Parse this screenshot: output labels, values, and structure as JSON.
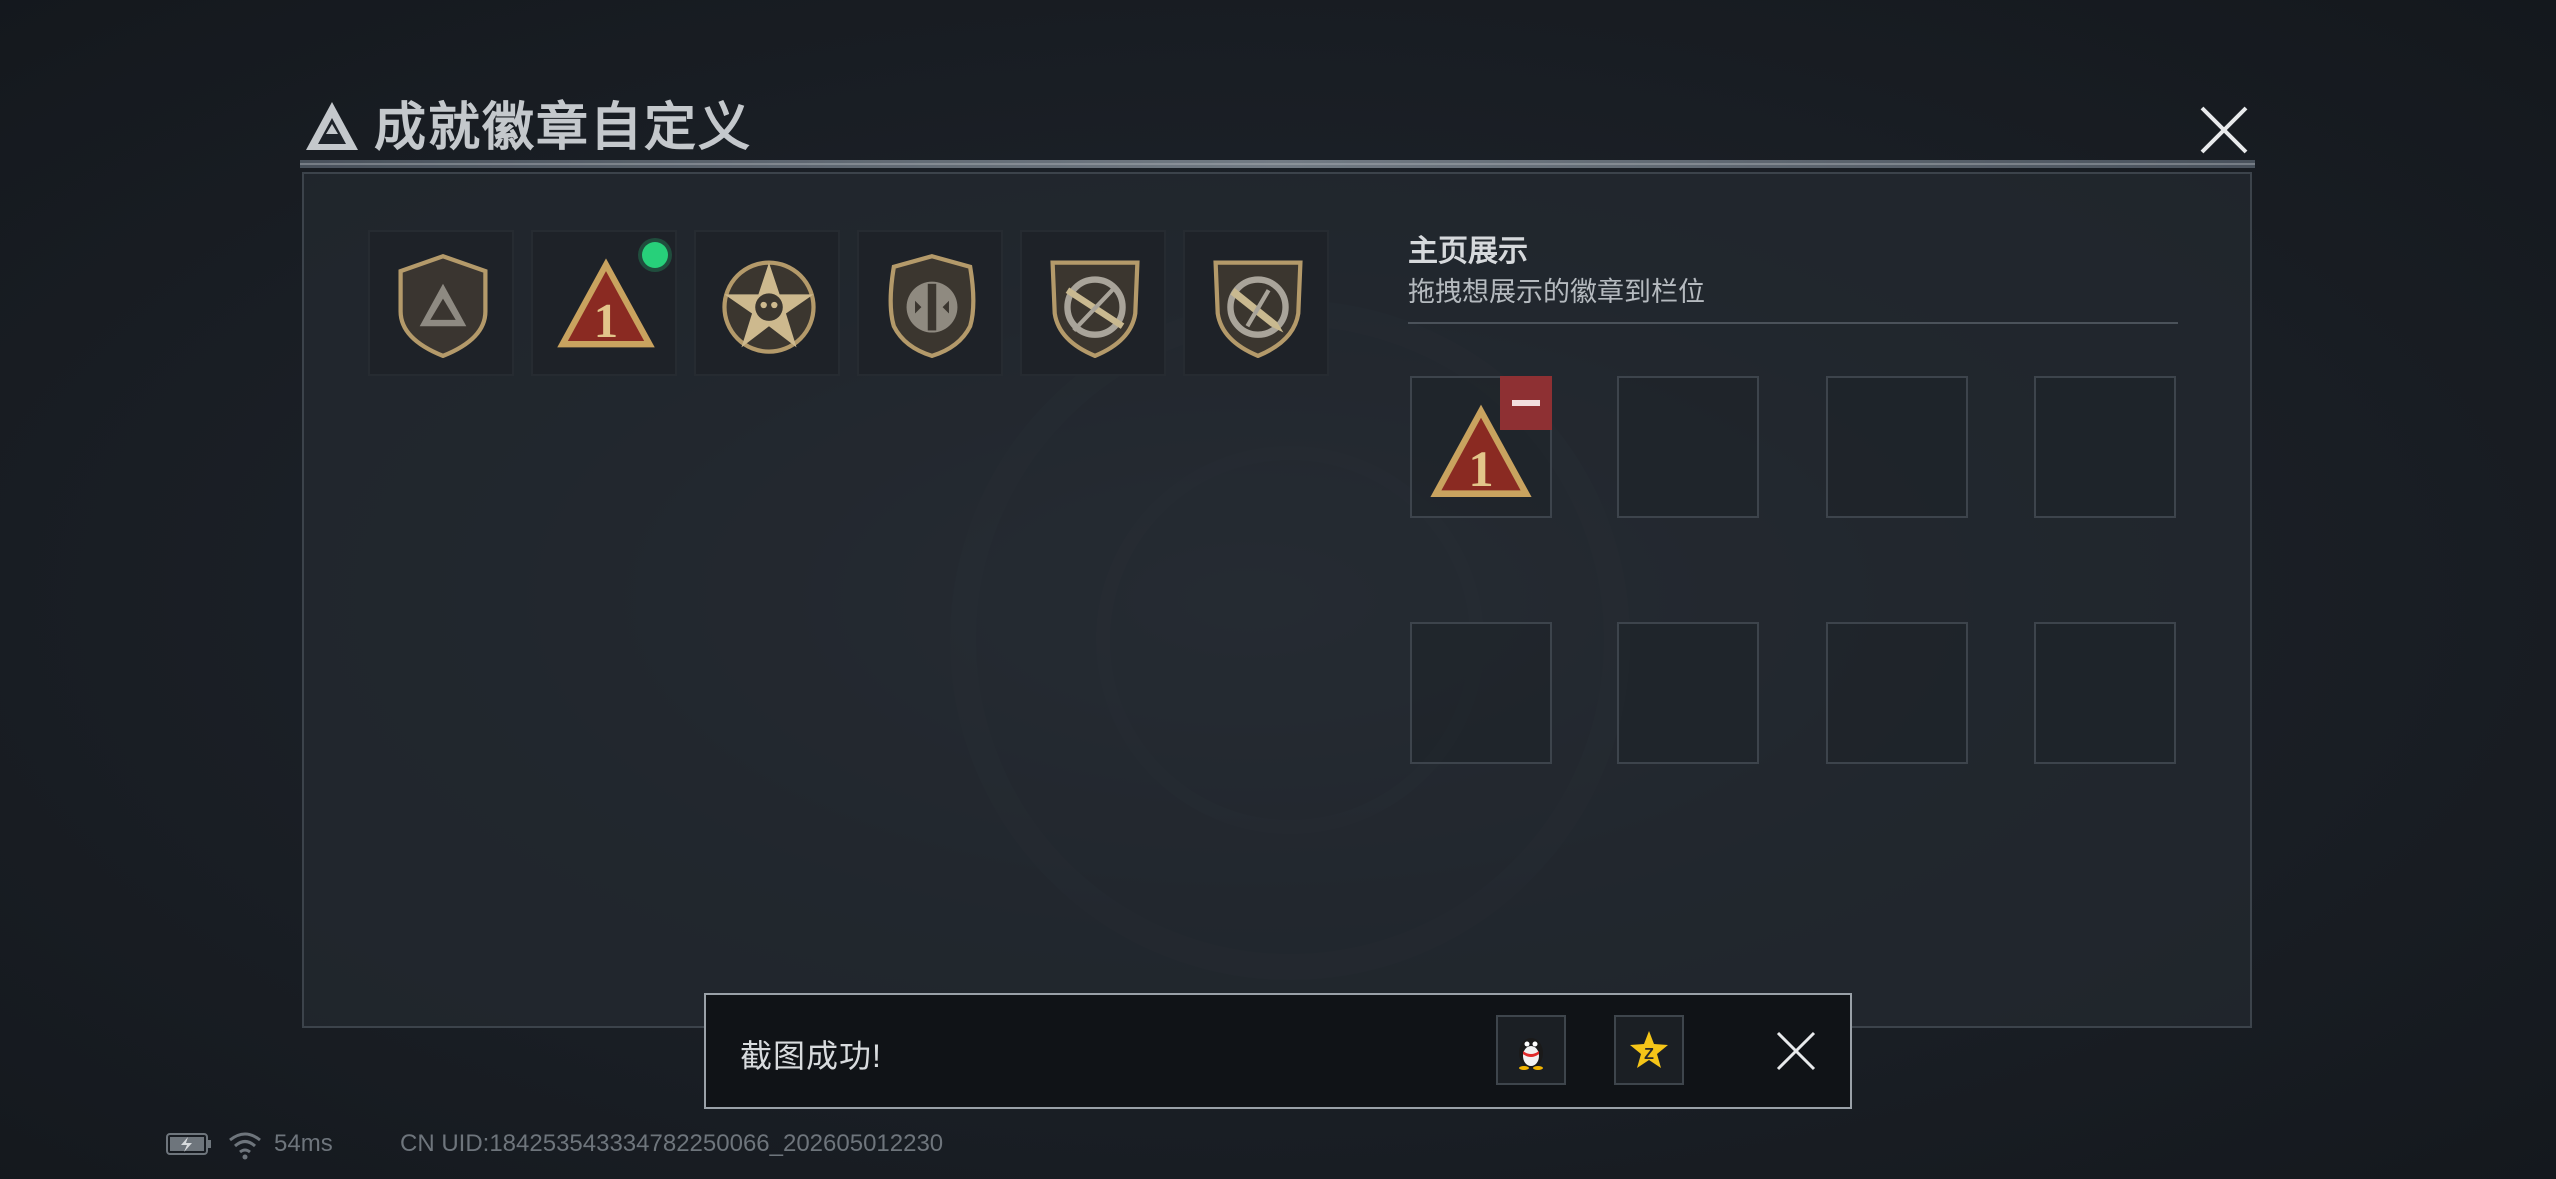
{
  "header": {
    "title": "成就徽章自定义"
  },
  "inventory": {
    "badges": [
      {
        "icon": "triangle-logo-shield-badge"
      },
      {
        "icon": "rank-one-triangle-badge",
        "is_new": true
      },
      {
        "icon": "star-skull-badge"
      },
      {
        "icon": "bullet-shield-badge"
      },
      {
        "icon": "rifle-shield-badge"
      },
      {
        "icon": "knife-shield-badge"
      }
    ]
  },
  "showcase": {
    "title": "主页展示",
    "subtitle": "拖拽想展示的徽章到栏位",
    "slots_filled": [
      "rank-one-triangle-badge"
    ],
    "slot_count": 8
  },
  "toast": {
    "message": "截图成功!",
    "share_qq_icon": "qq-penguin-icon",
    "share_qzone_icon": "qzone-star-icon"
  },
  "status": {
    "ping": "54ms",
    "uid": "CN UID:18425354333478225006​6_202605012230"
  },
  "colors": {
    "accent_green": "#27d07a",
    "remove_red": "#8e3033",
    "badge_gold": "#c9a35f",
    "badge_red": "#8a2a22"
  }
}
